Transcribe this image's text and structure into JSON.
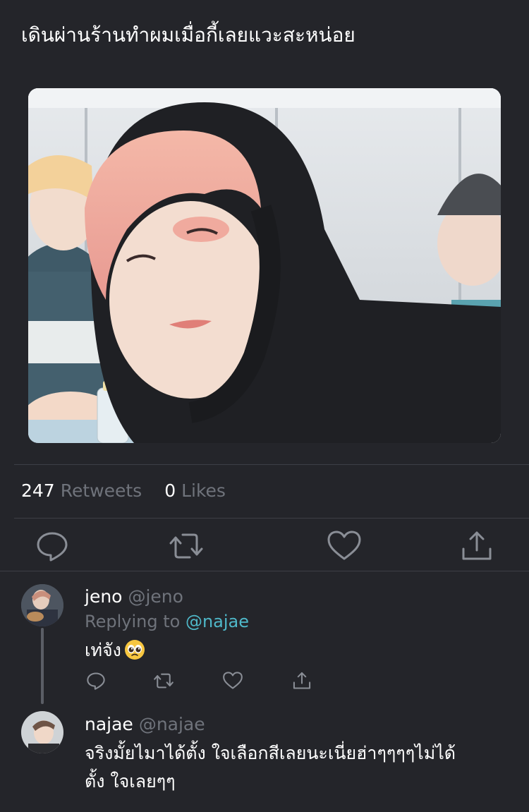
{
  "tweet": {
    "text": "เดินผ่านร้านทำผมเมื่อกี้เลยแวะสะหน่อย"
  },
  "stats": {
    "retweets_count": "247",
    "retweets_label": "Retweets",
    "likes_count": "0",
    "likes_label": "Likes"
  },
  "actions": {
    "reply_icon": "reply-icon",
    "retweet_icon": "retweet-icon",
    "like_icon": "heart-icon",
    "share_icon": "share-icon"
  },
  "replies": [
    {
      "name": "jeno",
      "handle": "@jeno",
      "replying_prefix": "Replying to",
      "replying_to": "@najae",
      "text": "เท่จัง",
      "emoji": "pleading-face-emoji"
    },
    {
      "name": "najae",
      "handle": "@najae",
      "text_line1": "จริงมั้ยไมาได้ตั้ง ใจเลือกสีเลยนะเนี่ยฮ่าๆๆๆๆไม่ได้",
      "text_line2": "ตั้ง ใจเลยๆๆ"
    }
  ],
  "colors": {
    "background": "#24252a",
    "muted_text": "#6f737b",
    "mention": "#4fb8c9",
    "divider": "#3d3f46"
  }
}
